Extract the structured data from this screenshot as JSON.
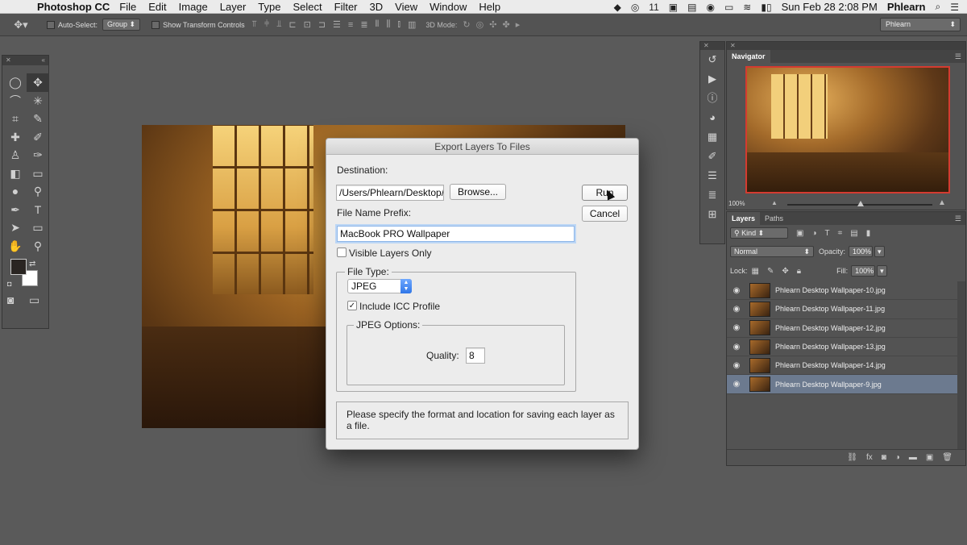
{
  "menubar": {
    "app_name": "Photoshop CC",
    "items": [
      "File",
      "Edit",
      "Image",
      "Layer",
      "Type",
      "Select",
      "Filter",
      "3D",
      "View",
      "Window",
      "Help"
    ],
    "badge": "11",
    "clock": "Sun Feb 28  2:08 PM",
    "user": "Phlearn"
  },
  "options_bar": {
    "auto_select_label": "Auto-Select:",
    "auto_select_value": "Group",
    "show_transform_label": "Show Transform Controls",
    "mode_3d_label": "3D Mode:",
    "workspace": "Phlearn"
  },
  "dialog": {
    "title": "Export Layers To Files",
    "destination_label": "Destination:",
    "destination_value": "/Users/Phlearn/Desktop/",
    "browse_label": "Browse...",
    "run_label": "Run",
    "cancel_label": "Cancel",
    "prefix_label": "File Name Prefix:",
    "prefix_value": "MacBook PRO Wallpaper",
    "visible_only_label": "Visible Layers Only",
    "visible_only_checked": false,
    "file_type_label": "File Type:",
    "file_type_value": "JPEG",
    "icc_label": "Include ICC Profile",
    "icc_checked": true,
    "jpeg_options_label": "JPEG Options:",
    "quality_label": "Quality:",
    "quality_value": "8",
    "message": "Please specify the format and location for saving each layer as a file."
  },
  "navigator": {
    "tab": "Navigator",
    "zoom": "100%"
  },
  "layers": {
    "tabs": [
      "Layers",
      "Paths"
    ],
    "kind_label": "Kind",
    "blend_mode": "Normal",
    "opacity_label": "Opacity:",
    "opacity_value": "100%",
    "lock_label": "Lock:",
    "fill_label": "Fill:",
    "fill_value": "100%",
    "items": [
      {
        "name": "Phlearn Desktop Wallpaper-10.jpg"
      },
      {
        "name": "Phlearn Desktop Wallpaper-11.jpg"
      },
      {
        "name": "Phlearn Desktop Wallpaper-12.jpg"
      },
      {
        "name": "Phlearn Desktop Wallpaper-13.jpg"
      },
      {
        "name": "Phlearn Desktop Wallpaper-14.jpg"
      },
      {
        "name": "Phlearn Desktop Wallpaper-9.jpg"
      }
    ],
    "selected_index": 5
  }
}
